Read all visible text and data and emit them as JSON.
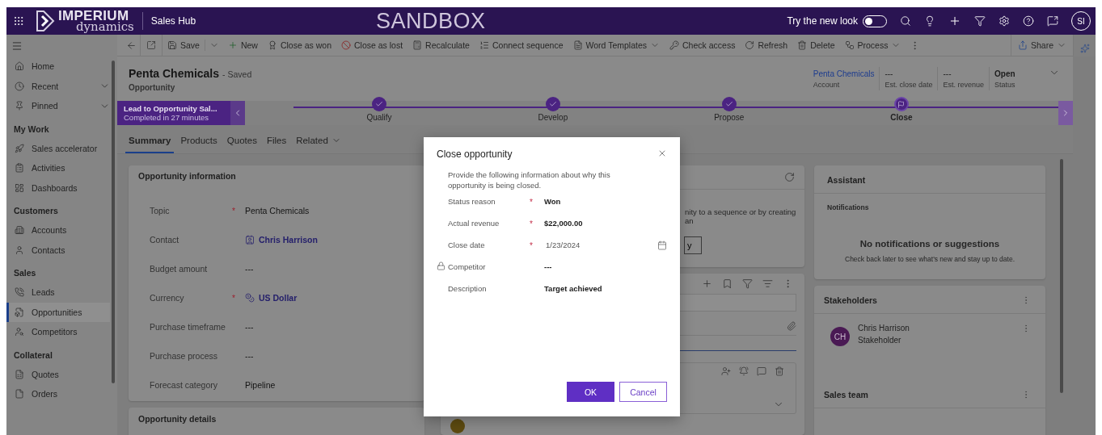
{
  "top_bar": {
    "logo_top": "IMPERIUM",
    "logo_bottom": "dynamics",
    "app_title": "Sales Hub",
    "environment": "SANDBOX",
    "new_look_label": "Try the new look",
    "new_look_on": false,
    "avatar": "SI"
  },
  "command_bar": {
    "commands": [
      {
        "label": "Save",
        "kind": "split"
      },
      {
        "label": "New",
        "kind": "plain"
      },
      {
        "label": "Close as won",
        "kind": "plain"
      },
      {
        "label": "Close as lost",
        "kind": "plain"
      },
      {
        "label": "Recalculate",
        "kind": "plain"
      },
      {
        "label": "Connect sequence",
        "kind": "plain"
      },
      {
        "label": "Word Templates",
        "kind": "menu"
      },
      {
        "label": "Check access",
        "kind": "plain"
      },
      {
        "label": "Refresh",
        "kind": "plain"
      },
      {
        "label": "Delete",
        "kind": "plain"
      },
      {
        "label": "Process",
        "kind": "menu"
      }
    ],
    "share": "Share"
  },
  "nav": {
    "groups": [
      {
        "items": [
          {
            "label": "Home",
            "expandable": false,
            "selected": false
          },
          {
            "label": "Recent",
            "expandable": true,
            "selected": false
          },
          {
            "label": "Pinned",
            "expandable": true,
            "selected": false
          }
        ]
      },
      {
        "title": "My Work",
        "items": [
          {
            "label": "Sales accelerator",
            "expandable": false,
            "selected": false
          },
          {
            "label": "Activities",
            "expandable": false,
            "selected": false
          },
          {
            "label": "Dashboards",
            "expandable": false,
            "selected": false
          }
        ]
      },
      {
        "title": "Customers",
        "items": [
          {
            "label": "Accounts",
            "expandable": false,
            "selected": false
          },
          {
            "label": "Contacts",
            "expandable": false,
            "selected": false
          }
        ]
      },
      {
        "title": "Sales",
        "items": [
          {
            "label": "Leads",
            "expandable": false,
            "selected": false
          },
          {
            "label": "Opportunities",
            "expandable": false,
            "selected": true
          },
          {
            "label": "Competitors",
            "expandable": false,
            "selected": false
          }
        ]
      },
      {
        "title": "Collateral",
        "items": [
          {
            "label": "Quotes",
            "expandable": false,
            "selected": false
          },
          {
            "label": "Orders",
            "expandable": false,
            "selected": false
          }
        ]
      }
    ]
  },
  "record_header": {
    "title": "Penta Chemicals",
    "save_state": "- Saved",
    "entity": "Opportunity",
    "fields": [
      {
        "value": "Penta Chemicals",
        "label": "Account",
        "kind": "link"
      },
      {
        "value": "---",
        "label": "Est. close date",
        "kind": "text"
      },
      {
        "value": "---",
        "label": "Est. revenue",
        "kind": "text"
      },
      {
        "value": "Open",
        "label": "Status",
        "kind": "status"
      }
    ]
  },
  "process_bar": {
    "process_name": "Lead to Opportunity Sal...",
    "duration": "Completed in 27 minutes",
    "stages": [
      {
        "label": "Qualify",
        "completed": true,
        "selected": false
      },
      {
        "label": "Develop",
        "completed": true,
        "selected": false
      },
      {
        "label": "Propose",
        "completed": true,
        "selected": false
      },
      {
        "label": "Close",
        "completed": false,
        "selected": true
      }
    ]
  },
  "tabs": [
    {
      "label": "Summary",
      "selected": true,
      "menu": false
    },
    {
      "label": "Products",
      "selected": false,
      "menu": false
    },
    {
      "label": "Quotes",
      "selected": false,
      "menu": false
    },
    {
      "label": "Files",
      "selected": false,
      "menu": false
    },
    {
      "label": "Related",
      "selected": false,
      "menu": true
    }
  ],
  "opportunity_information": {
    "title": "Opportunity information",
    "fields": [
      {
        "label": "Topic",
        "value": "Penta Chemicals",
        "required_mark": "*",
        "kind": "text"
      },
      {
        "label": "Contact",
        "value": "Chris Harrison",
        "kind": "contact"
      },
      {
        "label": "Budget amount",
        "value": "---",
        "kind": "text"
      },
      {
        "label": "Currency",
        "value": "US Dollar",
        "required_mark": "*",
        "kind": "currency"
      },
      {
        "label": "Purchase timeframe",
        "value": "---",
        "kind": "text"
      },
      {
        "label": "Purchase process",
        "value": "---",
        "kind": "text"
      },
      {
        "label": "Forecast category",
        "value": "Pipeline",
        "kind": "text"
      }
    ]
  },
  "opportunity_details": {
    "title": "Opportunity details"
  },
  "sequence_card": {
    "text": "nity to a sequence or by creating an",
    "button": "y"
  },
  "assistant": {
    "title": "Assistant",
    "section": "Notifications",
    "empty_title": "No notifications or suggestions",
    "empty_text": "Check back later to see what's new and stay up to date."
  },
  "stakeholders": {
    "title": "Stakeholders",
    "people": [
      {
        "initials": "CH",
        "name": "Chris Harrison",
        "role": "Stakeholder"
      }
    ]
  },
  "sales_team": {
    "title": "Sales team"
  },
  "dialog": {
    "title": "Close opportunity",
    "description": "Provide the following information about why this opportunity is being closed.",
    "fields": [
      {
        "label": "Status reason",
        "value": "Won",
        "required_mark": "*",
        "locked": false,
        "kind": "text"
      },
      {
        "label": "Actual revenue",
        "value": "$22,000.00",
        "required_mark": "*",
        "locked": false,
        "kind": "text"
      },
      {
        "label": "Close date",
        "value": "1/23/2024",
        "required_mark": "*",
        "locked": false,
        "kind": "date"
      },
      {
        "label": "Competitor",
        "value": "---",
        "locked": true,
        "kind": "text"
      },
      {
        "label": "Description",
        "value": "Target achieved",
        "locked": false,
        "kind": "text"
      }
    ],
    "ok": "OK",
    "cancel": "Cancel"
  }
}
